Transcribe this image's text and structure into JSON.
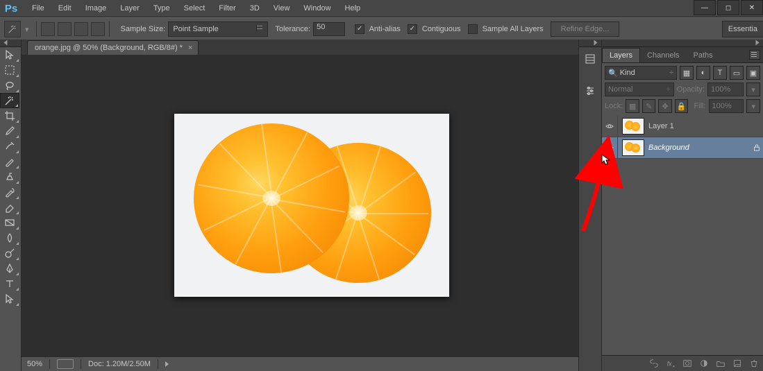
{
  "app": {
    "logo": "Ps"
  },
  "menus": [
    "File",
    "Edit",
    "Image",
    "Layer",
    "Type",
    "Select",
    "Filter",
    "3D",
    "View",
    "Window",
    "Help"
  ],
  "window_controls": [
    "minimize",
    "maximize",
    "close"
  ],
  "options_bar": {
    "sample_size_label": "Sample Size:",
    "sample_size_value": "Point Sample",
    "tolerance_label": "Tolerance:",
    "tolerance_value": "50",
    "antialias_label": "Anti-alias",
    "antialias_checked": true,
    "contiguous_label": "Contiguous",
    "contiguous_checked": true,
    "sample_all_label": "Sample All Layers",
    "sample_all_checked": false,
    "refine_edge_label": "Refine Edge...",
    "workspace_tab": "Essentia"
  },
  "document": {
    "tab_title": "orange.jpg @ 50% (Background, RGB/8#) *",
    "status_zoom": "50%",
    "status_doc": "Doc: 1.20M/2.50M"
  },
  "layers_panel": {
    "tabs": [
      "Layers",
      "Channels",
      "Paths"
    ],
    "filter_kind_label": "Kind",
    "blend_mode": "Normal",
    "opacity_label": "Opacity:",
    "opacity_value": "100%",
    "lock_label": "Lock:",
    "fill_label": "Fill:",
    "fill_value": "100%",
    "layers": [
      {
        "name": "Layer 1",
        "visible": true,
        "selected": false,
        "locked": false,
        "italic": false
      },
      {
        "name": "Background",
        "visible": true,
        "selected": true,
        "locked": true,
        "italic": true
      }
    ]
  },
  "search_icon": "🔍"
}
